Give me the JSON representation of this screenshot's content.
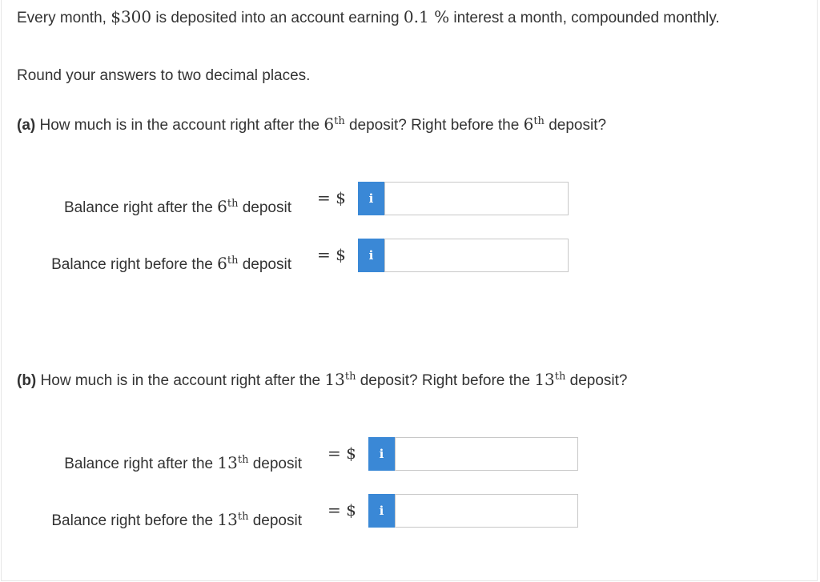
{
  "problem": {
    "intro_pre": "Every month, ",
    "deposit_amount": "$300",
    "intro_mid": " is deposited into an account earning ",
    "rate": "0.1 %",
    "intro_post": " interest a month, compounded monthly."
  },
  "round_instruction": "Round your answers to two decimal places.",
  "part_a": {
    "letter": "(a)",
    "q_pre": " How much is in the account right after the ",
    "num1": "6",
    "sup1": "th",
    "q_mid": " deposit? Right before the ",
    "num2": "6",
    "sup2": "th",
    "q_post": " deposit?",
    "rows": [
      {
        "label_pre": "Balance right after the ",
        "num": "6",
        "sup": "th",
        "label_post": " deposit",
        "eq": "= $",
        "info": "i",
        "value": ""
      },
      {
        "label_pre": "Balance right before the ",
        "num": "6",
        "sup": "th",
        "label_post": " deposit",
        "eq": "= $",
        "info": "i",
        "value": ""
      }
    ]
  },
  "part_b": {
    "letter": "(b)",
    "q_pre": " How much is in the account right after the ",
    "num1": "13",
    "sup1": "th",
    "q_mid": " deposit? Right before the ",
    "num2": "13",
    "sup2": "th",
    "q_post": " deposit?",
    "rows": [
      {
        "label_pre": "Balance right after the ",
        "num": "13",
        "sup": "th",
        "label_post": " deposit",
        "eq": "= $",
        "info": "i",
        "value": ""
      },
      {
        "label_pre": "Balance right before the ",
        "num": "13",
        "sup": "th",
        "label_post": " deposit",
        "eq": "= $",
        "info": "i",
        "value": ""
      }
    ]
  },
  "colors": {
    "info_button": "#3a88d6",
    "text": "#333333",
    "input_border": "#c8c8c8"
  }
}
